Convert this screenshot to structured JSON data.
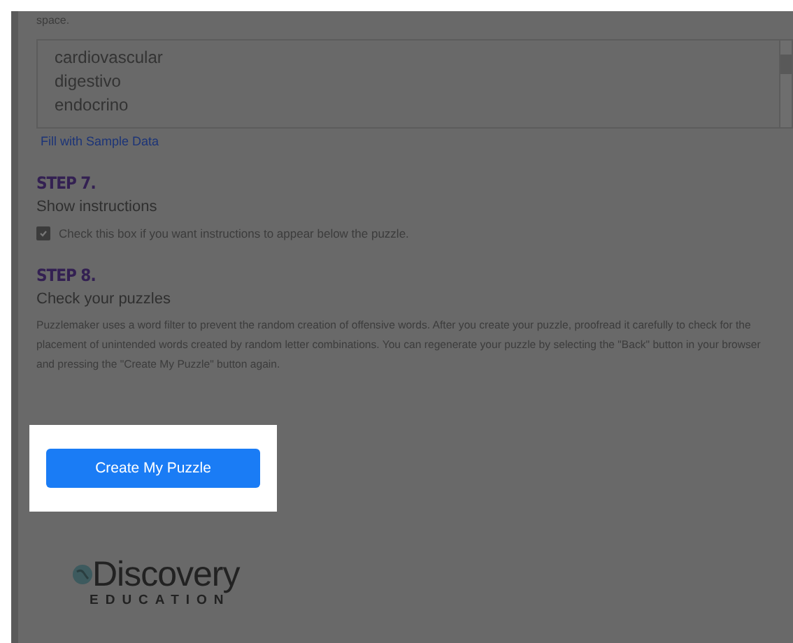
{
  "intro_tail": "space.",
  "word_list": {
    "items": [
      "cardiovascular",
      "digestivo",
      "endocrino"
    ]
  },
  "sample_link": "Fill with Sample Data",
  "steps": [
    {
      "kind": "checkbox",
      "label": "STEP 7.",
      "title": "Show instructions",
      "checkbox": {
        "label": "Check this box if you want instructions to appear below the puzzle.",
        "checked": true
      }
    },
    {
      "kind": "text",
      "label": "STEP 8.",
      "title": "Check your puzzles",
      "text": "Puzzlemaker uses a word filter to prevent the random creation of offensive words. After you create your puzzle, proofread it carefully to check for the placement of unintended words created by random letter combinations. You can regenerate your puzzle by selecting the \"Back\" button in your browser and pressing the \"Create My Puzzle\" button again."
    }
  ],
  "create_button": "Create My Puzzle",
  "logo": {
    "wordmark": "Discovery",
    "tagline": "EDUCATION"
  }
}
